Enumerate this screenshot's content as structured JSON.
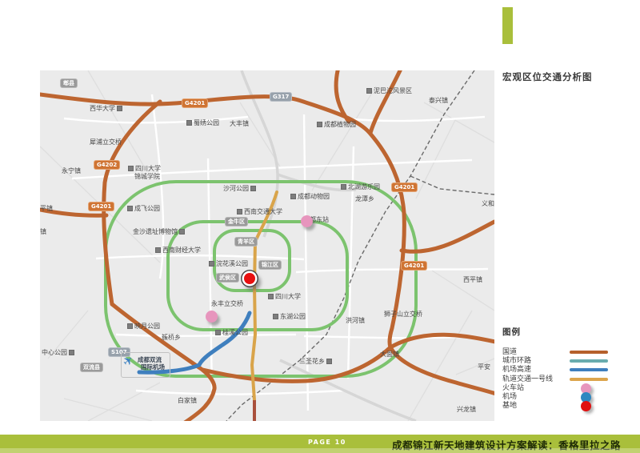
{
  "header": {
    "title": "宏观区位交通分析图"
  },
  "accent_bar_color": "#a9bf3b",
  "footer": {
    "page_label": "PAGE 10",
    "doc_title": "成都锦江新天地建筑设计方案解读：香格里拉之路",
    "bar_color": "#a9bf3b"
  },
  "legend": {
    "heading": "图例",
    "items": [
      {
        "label": "国道",
        "swatch": "line",
        "color": "#b5602c"
      },
      {
        "label": "城市环路",
        "swatch": "line",
        "color": "#6aacae"
      },
      {
        "label": "机场高速",
        "swatch": "line",
        "color": "#3f7fbe"
      },
      {
        "label": "轨道交通一号线",
        "swatch": "line",
        "color": "#dca54c"
      },
      {
        "label": "火车站",
        "swatch": "dot",
        "color": "#e795bd"
      },
      {
        "label": "机场",
        "swatch": "dot",
        "color": "#2f87c0"
      },
      {
        "label": "基地",
        "swatch": "dot",
        "color": "#e01010"
      }
    ]
  },
  "map": {
    "background_color": "#ebebeb",
    "ring_road_color": "#7cc36e",
    "national_road_color": "#bd6530",
    "airport_expressway_color": "#3f7fbe",
    "metro_line_color": "#d9a44a",
    "district_badges": [
      {
        "text": "郫县"
      },
      {
        "text": "金牛区"
      },
      {
        "text": "青羊区"
      },
      {
        "text": "锦江区"
      },
      {
        "text": "武侯区"
      },
      {
        "text": "双流县"
      }
    ],
    "road_badges": [
      {
        "text": "G4201"
      },
      {
        "text": "G4202"
      },
      {
        "text": "G4201"
      },
      {
        "text": "G317"
      },
      {
        "text": "G4201"
      },
      {
        "text": "G4201"
      },
      {
        "text": "S107"
      }
    ],
    "labels": [
      {
        "text": "西华大学"
      },
      {
        "text": "蜀绣公园"
      },
      {
        "text": "大丰镇"
      },
      {
        "text": "犀浦立交桥"
      },
      {
        "text": "永宁镇"
      },
      {
        "text": "四川大学"
      },
      {
        "text": "锦城学院"
      },
      {
        "text": "沙河公园"
      },
      {
        "text": "成飞公园"
      },
      {
        "text": "金沙遗址博物馆"
      },
      {
        "text": "平镇"
      },
      {
        "text": "镇"
      },
      {
        "text": "泥巴沱风景区"
      },
      {
        "text": "泰兴镇"
      },
      {
        "text": "成都植物园"
      },
      {
        "text": "北湖游乐园"
      },
      {
        "text": "龙潭乡"
      },
      {
        "text": "成都动物园"
      },
      {
        "text": "成都东站"
      },
      {
        "text": "义和乡"
      },
      {
        "text": "西南交通大学"
      },
      {
        "text": "西南财经大学"
      },
      {
        "text": "浣花溪公园"
      },
      {
        "text": "四川大学"
      },
      {
        "text": "永丰立交桥"
      },
      {
        "text": "东湖公园"
      },
      {
        "text": "洪河镇"
      },
      {
        "text": "狮子山立交桥"
      },
      {
        "text": "西平镇"
      },
      {
        "text": "簇桥乡"
      },
      {
        "text": "映月公园"
      },
      {
        "text": "中心公园"
      },
      {
        "text": "白家镇"
      },
      {
        "text": "三圣花乡"
      },
      {
        "text": "大面镇"
      },
      {
        "text": "平安"
      },
      {
        "text": "兴龙镇"
      },
      {
        "text": "桂溪公园"
      }
    ],
    "airport": {
      "line1": "成都双流",
      "line2": "国际机场"
    },
    "markers": [
      {
        "type": "train-station",
        "color": "#e795bd"
      },
      {
        "type": "train-station",
        "color": "#e795bd"
      },
      {
        "type": "airport",
        "color": "#2f87c0"
      },
      {
        "type": "site",
        "color": "#e01010"
      }
    ]
  }
}
